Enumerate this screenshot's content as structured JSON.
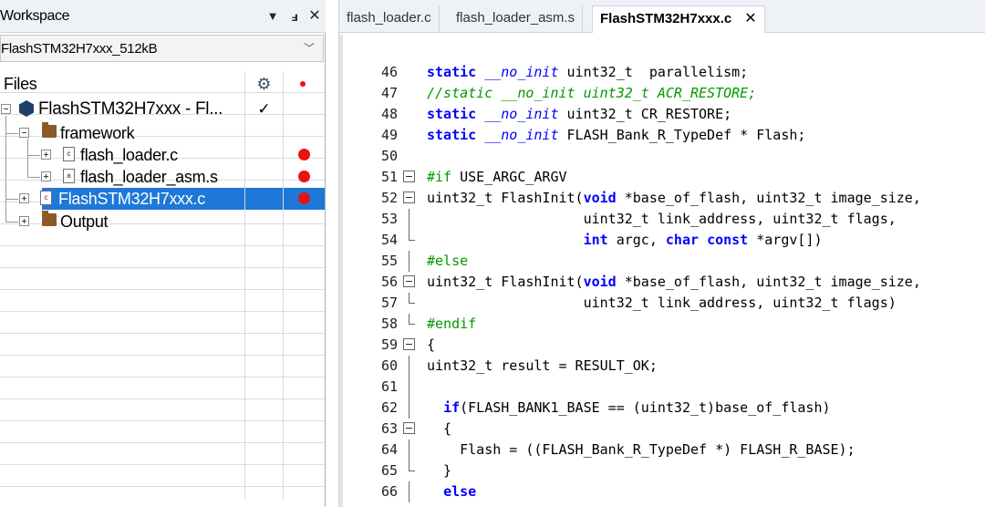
{
  "workspace": {
    "title": "Workspace",
    "pin_glyph": "▼",
    "float_glyph": "📌",
    "close_glyph": "✕",
    "config_value": "FlashSTM32H7xxx_512kB",
    "files_header": "Files",
    "tree": [
      {
        "label": "FlashSTM32H7xxx - Fl...",
        "checked": "✓",
        "dot": "small"
      },
      {
        "label": "framework"
      },
      {
        "label": "flash_loader.c",
        "dot": "big"
      },
      {
        "label": "flash_loader_asm.s",
        "dot": "big"
      },
      {
        "label": "FlashSTM32H7xxx.c",
        "dot": "big",
        "selected": true
      },
      {
        "label": "Output"
      }
    ]
  },
  "editor": {
    "tabs": [
      {
        "label": "flash_loader.c"
      },
      {
        "label": "flash_loader_asm.s"
      },
      {
        "label": "FlashSTM32H7xxx.c",
        "active": true,
        "close": "✕"
      }
    ],
    "first_line": 46,
    "lines": [
      "46",
      "47",
      "48",
      "49",
      "50",
      "51",
      "52",
      "53",
      "54",
      "55",
      "56",
      "57",
      "58",
      "59",
      "60",
      "61",
      "62",
      "63",
      "64",
      "65",
      "66"
    ]
  },
  "colors": {
    "selection": "#1e78d7",
    "keyword": "#0000ff",
    "comment": "#009900",
    "breakpoint": "#e81212"
  }
}
